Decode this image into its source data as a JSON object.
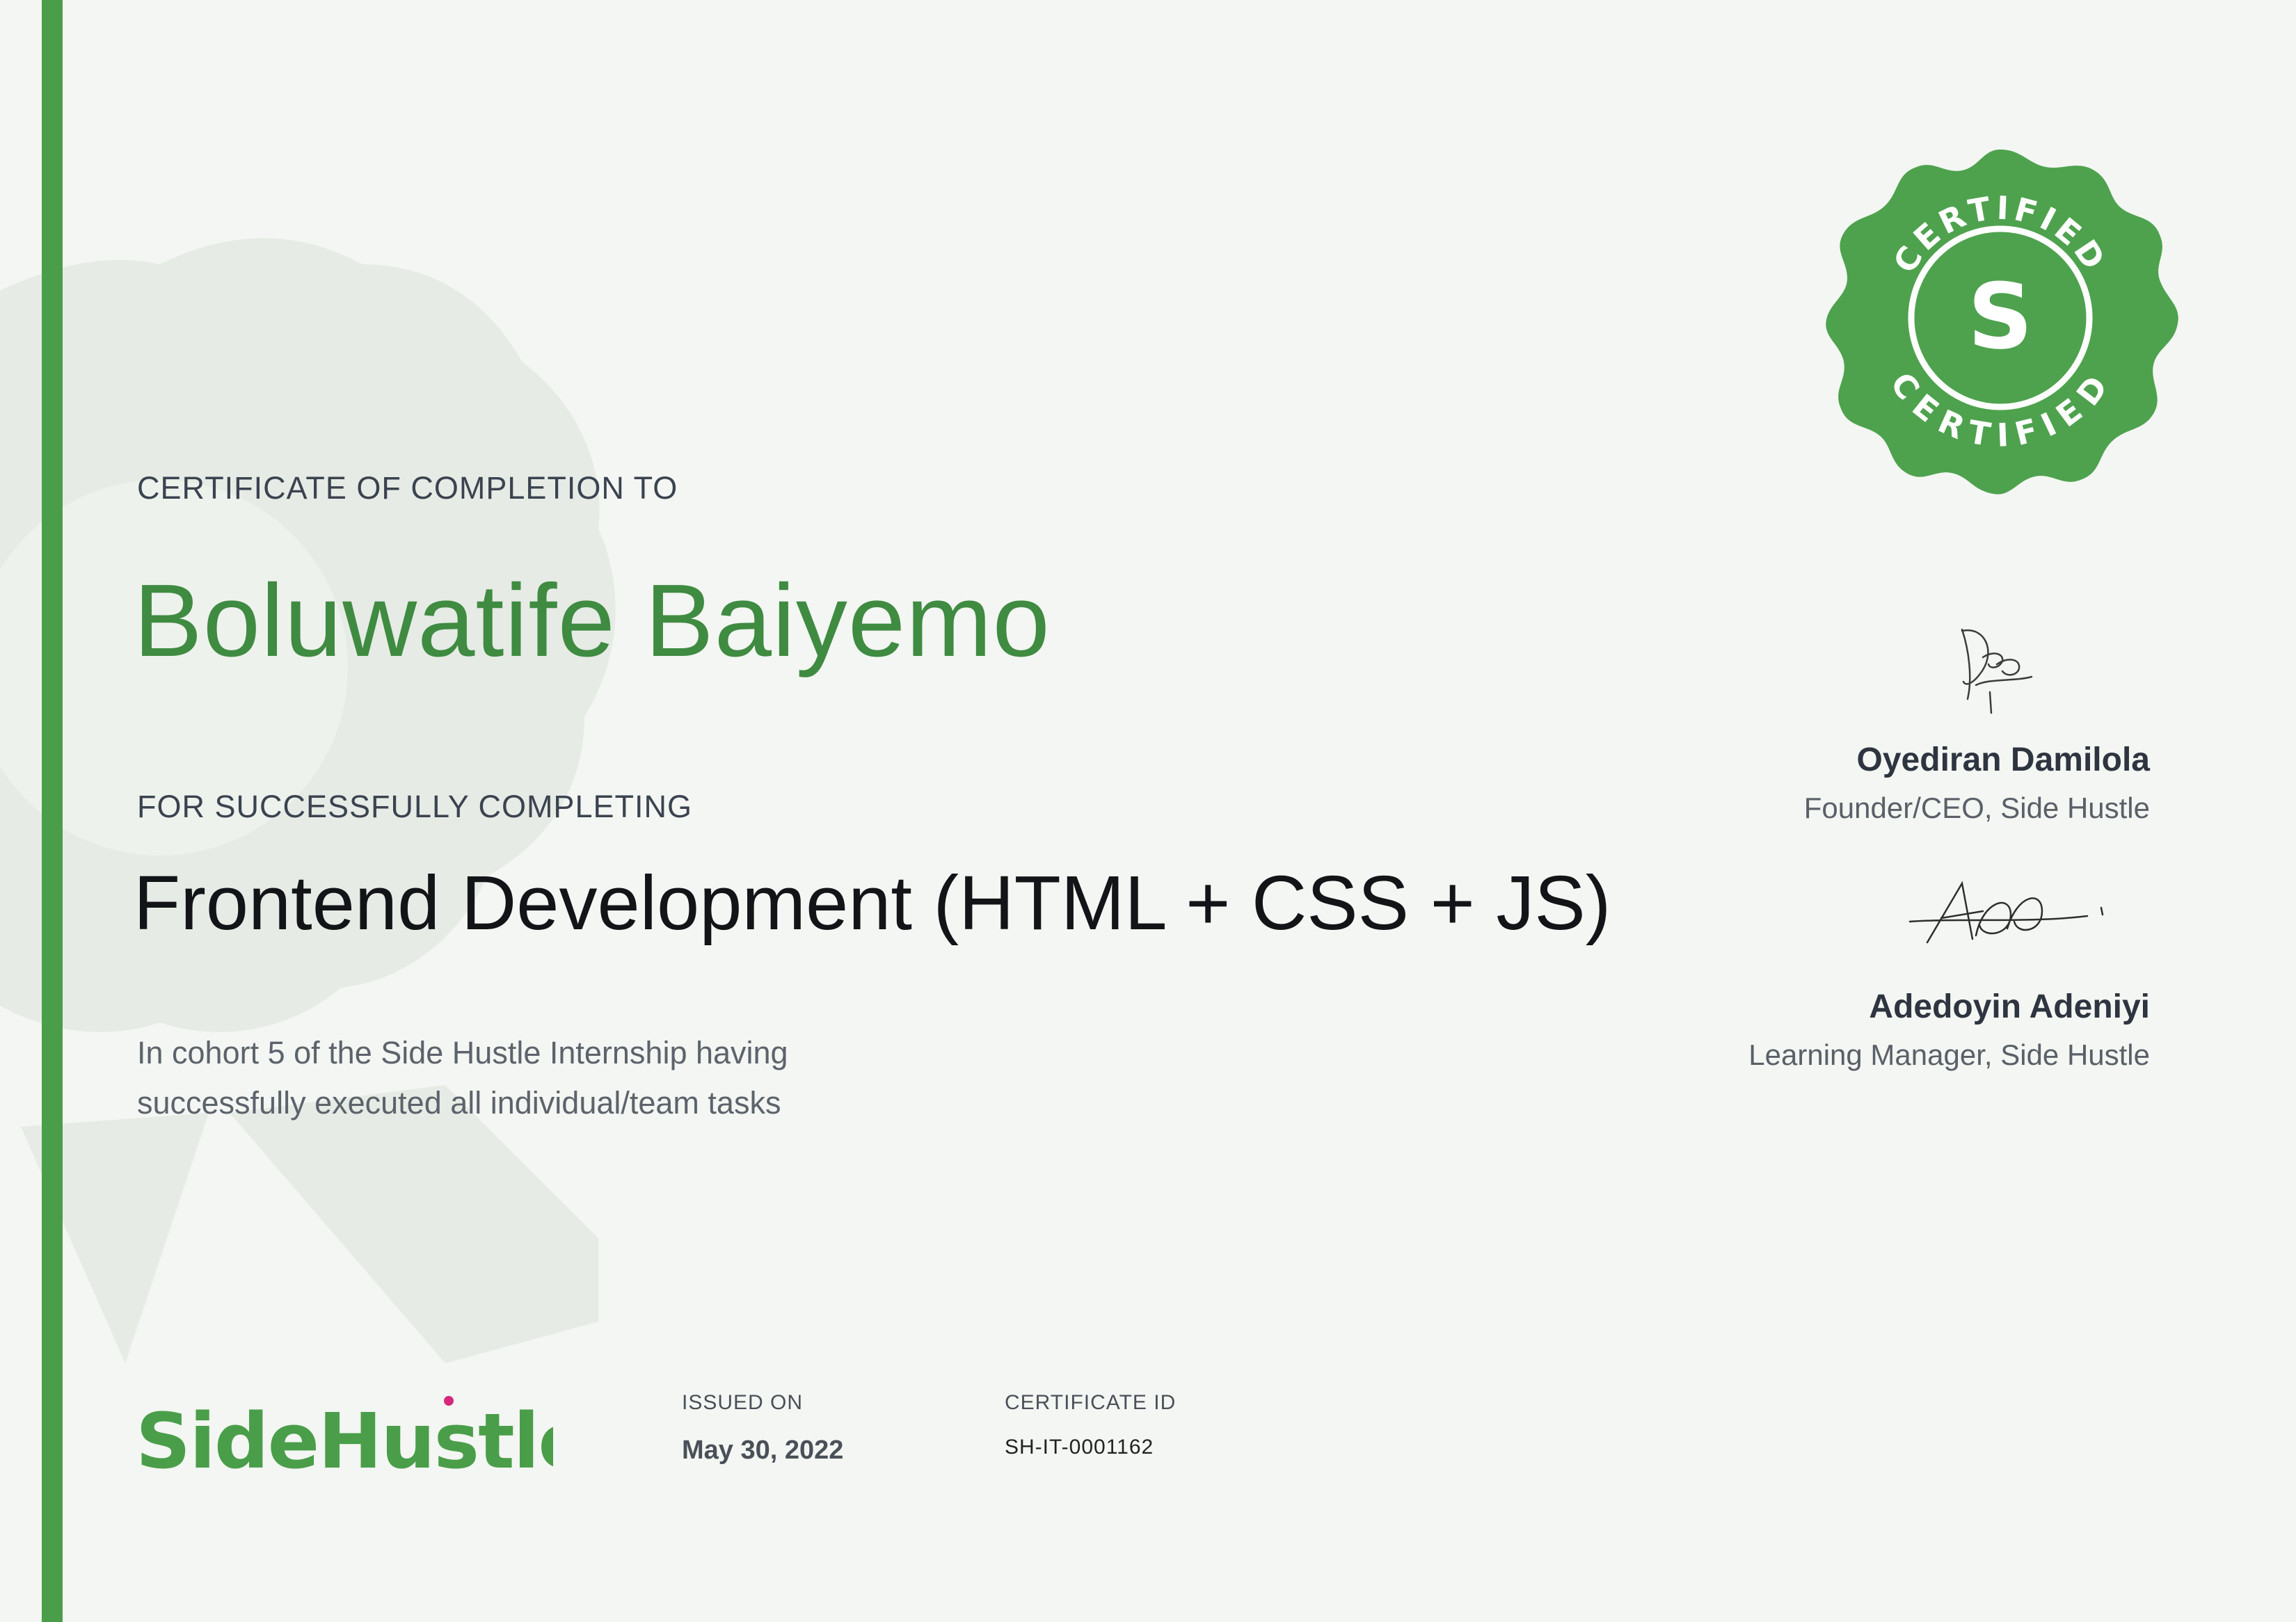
{
  "certificate": {
    "eyebrow_recipient": "CERTIFICATE OF COMPLETION TO",
    "recipient_name": "Boluwatife Baiyemo",
    "eyebrow_course": "FOR SUCCESSFULLY COMPLETING",
    "course_title": "Frontend Development (HTML + CSS + JS)",
    "description_lines": [
      "In cohort 5 of the Side Hustle Internship having",
      "successfully executed all individual/team tasks"
    ]
  },
  "seal": {
    "text_top": "CERTIFIED",
    "text_bottom": "CERTIFIED",
    "letter": "S",
    "color": "#4ea24e"
  },
  "signatories": [
    {
      "name": "Oyediran Damilola",
      "role": "Founder/CEO, Side Hustle"
    },
    {
      "name": "Adedoyin Adeniyi",
      "role": "Learning Manager, Side Hustle"
    }
  ],
  "footer": {
    "logo_text": "SideHustle",
    "issued_label": "ISSUED ON",
    "issued_value": "May 30, 2022",
    "id_label": "CERTIFICATE ID",
    "id_value": "SH-IT-0001162"
  },
  "colors": {
    "accent": "#4a9e4a",
    "name_green": "#3f8b41",
    "background": "#f3f6f2",
    "logo_dot": "#d6287c"
  }
}
